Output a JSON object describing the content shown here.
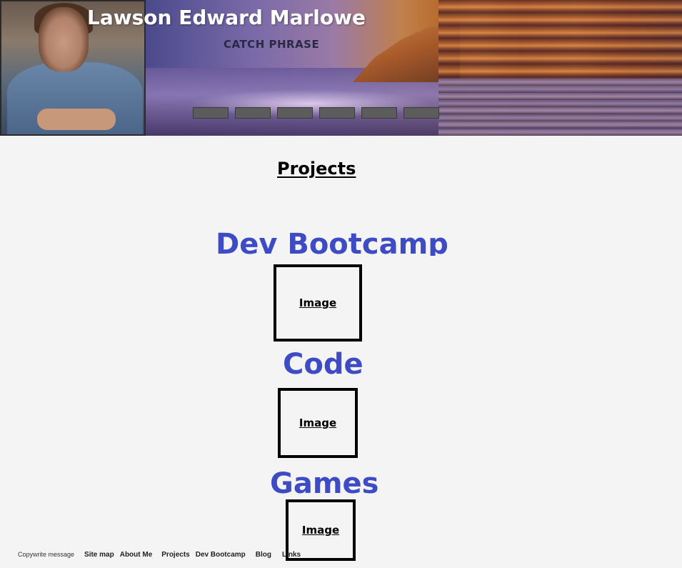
{
  "header": {
    "name": "Lawson Edward Marlowe",
    "catch_phrase": "CATCH PHRASE",
    "nav_buttons": [
      "",
      "",
      "",
      "",
      "",
      ""
    ]
  },
  "main": {
    "title": "Projects",
    "sections": [
      {
        "heading": "Dev Bootcamp",
        "image_label": "Image"
      },
      {
        "heading": "Code",
        "image_label": "Image"
      },
      {
        "heading": "Games",
        "image_label": "Image"
      }
    ]
  },
  "footer": {
    "copyright": "Copywrite message",
    "links": [
      "Site map",
      "About Me",
      "Projects",
      "Dev Bootcamp",
      "Blog",
      "Links"
    ]
  },
  "colors": {
    "heading_accent": "#3d4bc4",
    "background": "#f4f4f4",
    "nav_button": "#5c5c5c"
  }
}
